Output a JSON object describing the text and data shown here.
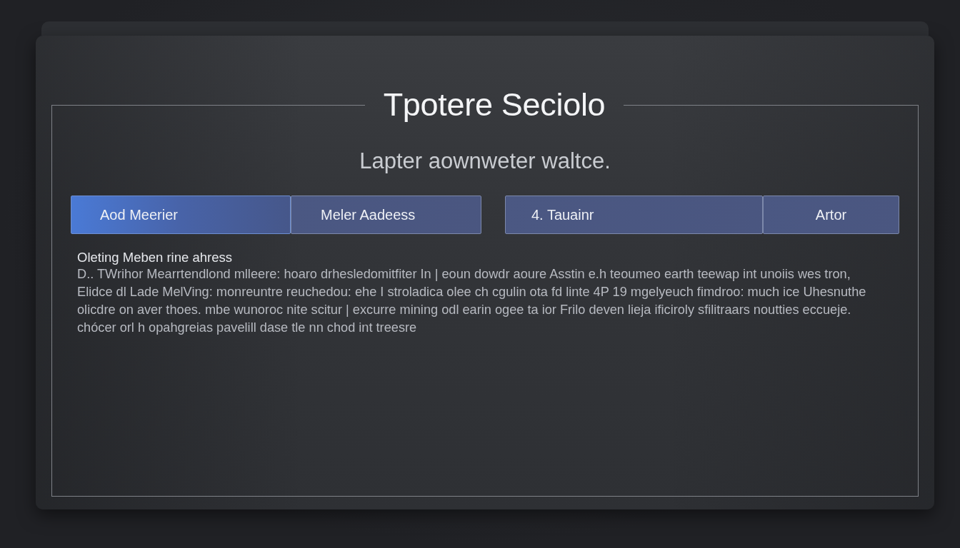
{
  "dialog": {
    "title": "Tpotere Seciolo",
    "subtitle": "Lapter aownweter waltce.",
    "button_groups": [
      {
        "buttons": [
          {
            "label": "Aod Meerier",
            "selected": true
          },
          {
            "label": "Meler Aadeess",
            "selected": false
          }
        ]
      },
      {
        "buttons": [
          {
            "label": "4. Tauainr",
            "selected": false
          },
          {
            "label": "Artor",
            "selected": false
          }
        ]
      }
    ],
    "section_heading": "Oleting Meben rine ahress",
    "body_lines": [
      "D.. TWrihor Mearrtendlond mlleere: hoaro drhesledomitfiter In | eoun dowdr aoure Asstin e.h teoumeo earth teewap int unoiis wes tron,",
      "Elidce  dl Lade MelVing: monreuntre reuchedou: ehe I stroladica olee ch cgulin ota fd linte 4P 19 mgelyeuch fimdroo: much ice Uhesnuthe",
      "olicdre on aver thoes. mbe wunoroc nite scitur | excurre mining odl earin ogee ta ior Frilo deven lieja ificiroly sfilitraars noutties eccueje.",
      "chócer orl h opahgreias pavelill dase tle nn chod int treesre"
    ]
  }
}
